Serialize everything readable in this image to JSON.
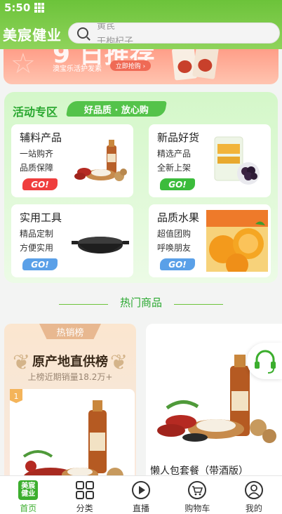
{
  "status": {
    "time": "5:50"
  },
  "header": {
    "brand": "美宸健业",
    "search_hint_1": "黄芪",
    "search_hint_2": "干枸杞子"
  },
  "banner": {
    "big_text": "9 日推荐",
    "sub": "澳宝乐活护发素",
    "button": "立即抢购 ›"
  },
  "activity": {
    "title": "活动专区",
    "slogan": "好品质 · 放心购",
    "cards": [
      {
        "title": "辅料产品",
        "line1": "一站购齐",
        "line2": "品质保障",
        "go": "GO!",
        "go_color": "red",
        "image": "dates-walnut-vinegar-image"
      },
      {
        "title": "新品好货",
        "line1": "精选产品",
        "line2": "全新上架",
        "go": "GO!",
        "go_color": "green",
        "image": "dried-fruit-package-image"
      },
      {
        "title": "实用工具",
        "line1": "精品定制",
        "line2": "方便实用",
        "go": "GO!",
        "go_color": "blue",
        "image": "wok-pan-image"
      },
      {
        "title": "品质水果",
        "line1": "超值团购",
        "line2": "呼唤朋友",
        "go": "GO!",
        "go_color": "blue",
        "image": "oranges-image"
      }
    ]
  },
  "hot": {
    "title": "热门商品",
    "rank_tag": "热销榜",
    "rank_title": "原产地直供榜",
    "rank_sub": "上榜近期销量18.2万+",
    "rank_badge": "1",
    "product_name": "懒人包套餐（带酒版）"
  },
  "tabs": [
    {
      "label": "首页",
      "icon": "home-logo-icon",
      "active": true
    },
    {
      "label": "分类",
      "icon": "category-grid-icon",
      "active": false
    },
    {
      "label": "直播",
      "icon": "play-icon",
      "active": false
    },
    {
      "label": "购物车",
      "icon": "cart-icon",
      "active": false
    },
    {
      "label": "我的",
      "icon": "user-icon",
      "active": false
    }
  ],
  "colors": {
    "brand_green": "#6cc33a",
    "active_tab": "#3cae2e"
  }
}
